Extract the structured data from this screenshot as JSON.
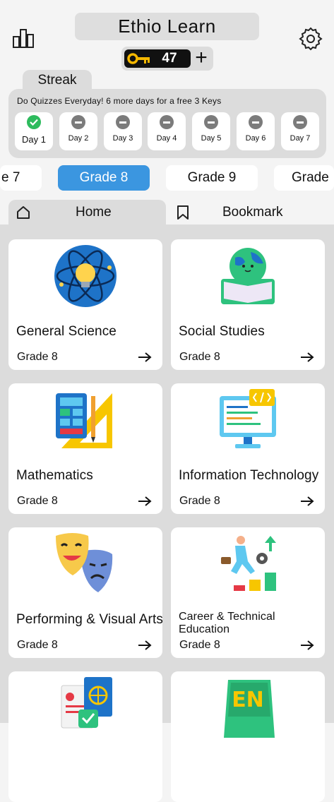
{
  "header": {
    "title": "Ethio Learn",
    "keys": "47",
    "plus": "+"
  },
  "streak": {
    "tab_label": "Streak",
    "message": "Do Quizzes Everyday! 6 more days for a free 3 Keys",
    "days": [
      {
        "label": "Day 1",
        "done": true
      },
      {
        "label": "Day 2",
        "done": false
      },
      {
        "label": "Day 3",
        "done": false
      },
      {
        "label": "Day 4",
        "done": false
      },
      {
        "label": "Day 5",
        "done": false
      },
      {
        "label": "Day 6",
        "done": false
      },
      {
        "label": "Day 7",
        "done": false
      }
    ]
  },
  "grades": {
    "items": [
      "e 7",
      "Grade 8",
      "Grade 9",
      "Grade"
    ],
    "selected": "Grade 8"
  },
  "nav": {
    "home": "Home",
    "bookmark": "Bookmark"
  },
  "subjects": [
    {
      "name": "General Science",
      "grade": "Grade 8",
      "icon": "atom-bulb-icon"
    },
    {
      "name": "Social Studies",
      "grade": "Grade 8",
      "icon": "globe-book-icon"
    },
    {
      "name": "Mathematics",
      "grade": "Grade 8",
      "icon": "calculator-ruler-icon"
    },
    {
      "name": "Information Technology",
      "grade": "Grade 8",
      "icon": "computer-code-icon"
    },
    {
      "name": "Performing & Visual Arts",
      "grade": "Grade 8",
      "icon": "theater-masks-icon"
    },
    {
      "name": "Career & Technical Education",
      "grade": "Grade 8",
      "icon": "career-climb-icon"
    },
    {
      "name": "",
      "grade": "",
      "icon": "passport-id-icon"
    },
    {
      "name": "",
      "grade": "",
      "icon": "english-book-icon"
    }
  ],
  "colors": {
    "accent": "#3b96e0",
    "check": "#2dbb5d",
    "disabled": "#7b7b7b"
  }
}
